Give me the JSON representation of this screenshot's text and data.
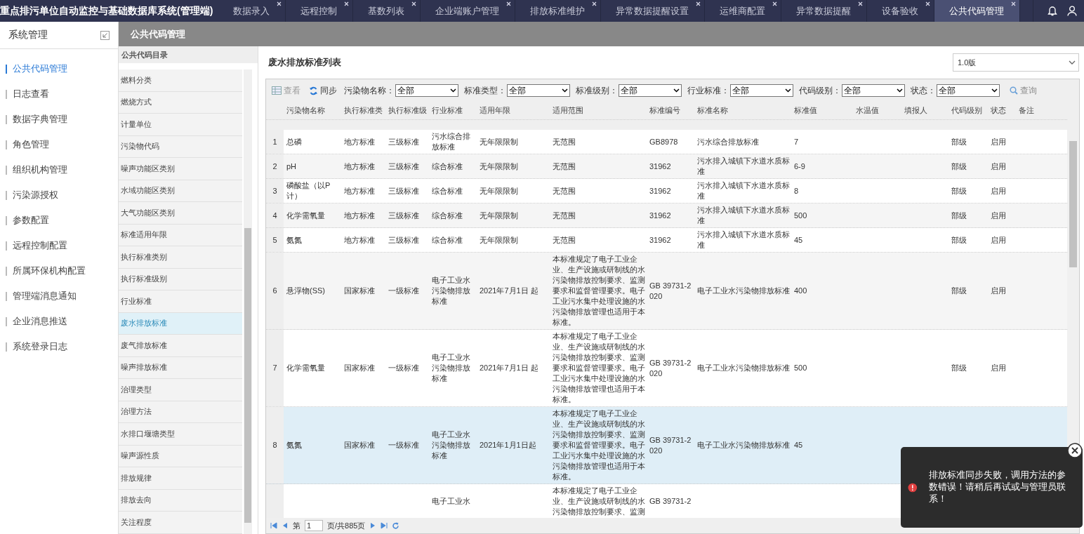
{
  "app_title": "重点排污单位自动监控与基础数据库系统(管理端)",
  "tabs": [
    {
      "label": "数据录入",
      "selected": false
    },
    {
      "label": "远程控制",
      "selected": false
    },
    {
      "label": "基数列表",
      "selected": false
    },
    {
      "label": "企业端账户管理",
      "selected": false
    },
    {
      "label": "排放标准维护",
      "selected": false
    },
    {
      "label": "异常数据提醒设置",
      "selected": false
    },
    {
      "label": "运维商配置",
      "selected": false
    },
    {
      "label": "异常数据提醒",
      "selected": false
    },
    {
      "label": "设备验收",
      "selected": false
    },
    {
      "label": "公共代码管理",
      "selected": true
    }
  ],
  "sidebar": {
    "title": "系统管理",
    "items": [
      {
        "label": "公共代码管理",
        "selected": true
      },
      {
        "label": "日志查看",
        "selected": false
      },
      {
        "label": "数据字典管理",
        "selected": false
      },
      {
        "label": "角色管理",
        "selected": false
      },
      {
        "label": "组织机构管理",
        "selected": false
      },
      {
        "label": "污染源授权",
        "selected": false
      },
      {
        "label": "参数配置",
        "selected": false
      },
      {
        "label": "远程控制配置",
        "selected": false
      },
      {
        "label": "所属环保机构配置",
        "selected": false
      },
      {
        "label": "管理端消息通知",
        "selected": false
      },
      {
        "label": "企业消息推送",
        "selected": false
      },
      {
        "label": "系统登录日志",
        "selected": false
      }
    ]
  },
  "page_header": "公共代码管理",
  "directory": {
    "title": "公共代码目录",
    "items": [
      {
        "label": "燃料分类",
        "selected": false
      },
      {
        "label": "燃烧方式",
        "selected": false
      },
      {
        "label": "计量单位",
        "selected": false
      },
      {
        "label": "污染物代码",
        "selected": false
      },
      {
        "label": "噪声功能区类别",
        "selected": false
      },
      {
        "label": "水域功能区类别",
        "selected": false
      },
      {
        "label": "大气功能区类别",
        "selected": false
      },
      {
        "label": "标准适用年限",
        "selected": false
      },
      {
        "label": "执行标准类别",
        "selected": false
      },
      {
        "label": "执行标准级别",
        "selected": false
      },
      {
        "label": "行业标准",
        "selected": false
      },
      {
        "label": "废水排放标准",
        "selected": true
      },
      {
        "label": "废气排放标准",
        "selected": false
      },
      {
        "label": "噪声排放标准",
        "selected": false
      },
      {
        "label": "治理类型",
        "selected": false
      },
      {
        "label": "治理方法",
        "selected": false
      },
      {
        "label": "水排口堰塘类型",
        "selected": false
      },
      {
        "label": "噪声源性质",
        "selected": false
      },
      {
        "label": "排放规律",
        "selected": false
      },
      {
        "label": "排放去向",
        "selected": false
      },
      {
        "label": "关注程度",
        "selected": false
      }
    ]
  },
  "list": {
    "title": "废水排放标准列表",
    "version": "1.0版"
  },
  "toolbar": {
    "buttons": [
      {
        "kind": "view",
        "label": "查看",
        "disabled": true
      },
      {
        "kind": "sync",
        "label": "同步",
        "disabled": false
      }
    ],
    "filters": [
      {
        "label": "污染物名称：",
        "value": "全部"
      },
      {
        "label": "标准类型：",
        "value": "全部"
      },
      {
        "label": "标准级别：",
        "value": "全部"
      },
      {
        "label": "行业标准：",
        "value": "全部"
      },
      {
        "label": "代码级别：",
        "value": "全部"
      },
      {
        "label": "状态：",
        "value": "全部"
      }
    ],
    "search": "查询"
  },
  "table": {
    "columns": [
      "污染物名称",
      "执行标准类",
      "执行标准级",
      "行业标准",
      "适用年限",
      "适用范围",
      "标准编号",
      "标准名称",
      "标准值",
      "水温值",
      "填报人",
      "代码级别",
      "状态",
      "备注"
    ],
    "rows": [
      {
        "no": "1",
        "pollutant": "总磷",
        "std_type": "地方标准",
        "std_level": "三级标准",
        "industry": "污水综合排放标准",
        "period": "无年限限制",
        "scope": "无范围",
        "code": "GB8978",
        "name": "污水综合排放标准",
        "value": "7",
        "level_code": "部级",
        "status": "启用",
        "selected": false
      },
      {
        "no": "2",
        "pollutant": "pH",
        "std_type": "地方标准",
        "std_level": "三级标准",
        "industry": "综合标准",
        "period": "无年限限制",
        "scope": "无范围",
        "code": "31962",
        "name": "污水排入城镇下水道水质标准",
        "value": "6-9",
        "level_code": "部级",
        "status": "启用",
        "selected": false
      },
      {
        "no": "3",
        "pollutant": "磷酸盐（以P计）",
        "std_type": "地方标准",
        "std_level": "三级标准",
        "industry": "综合标准",
        "period": "无年限限制",
        "scope": "无范围",
        "code": "31962",
        "name": "污水排入城镇下水道水质标准",
        "value": "8",
        "level_code": "部级",
        "status": "启用",
        "selected": false
      },
      {
        "no": "4",
        "pollutant": "化学需氧量",
        "std_type": "地方标准",
        "std_level": "三级标准",
        "industry": "综合标准",
        "period": "无年限限制",
        "scope": "无范围",
        "code": "31962",
        "name": "污水排入城镇下水道水质标准",
        "value": "500",
        "level_code": "部级",
        "status": "启用",
        "selected": false
      },
      {
        "no": "5",
        "pollutant": "氨氮",
        "std_type": "地方标准",
        "std_level": "三级标准",
        "industry": "综合标准",
        "period": "无年限限制",
        "scope": "无范围",
        "code": "31962",
        "name": "污水排入城镇下水道水质标准",
        "value": "45",
        "level_code": "部级",
        "status": "启用",
        "selected": false
      },
      {
        "no": "6",
        "pollutant": "悬浮物(SS)",
        "std_type": "国家标准",
        "std_level": "一级标准",
        "industry": "电子工业水污染物排放标准",
        "period": "2021年7月1日 起",
        "scope": "本标准规定了电子工业企业、生产设施或研制线的水污染物排放控制要求、监测要求和监督管理要求。电子工业污水集中处理设施的水污染物排放管理也适用于本标准。",
        "code": "GB 39731-2020",
        "name": "电子工业水污染物排放标准",
        "value": "400",
        "level_code": "部级",
        "status": "启用",
        "selected": false
      },
      {
        "no": "7",
        "pollutant": "化学需氧量",
        "std_type": "国家标准",
        "std_level": "一级标准",
        "industry": "电子工业水污染物排放标准",
        "period": "2021年7月1日 起",
        "scope": "本标准规定了电子工业企业、生产设施或研制线的水污染物排放控制要求、监测要求和监督管理要求。电子工业污水集中处理设施的水污染物排放管理也适用于本标准。",
        "code": "GB 39731-2020",
        "name": "电子工业水污染物排放标准",
        "value": "500",
        "level_code": "部级",
        "status": "启用",
        "selected": false
      },
      {
        "no": "8",
        "pollutant": "氨氮",
        "std_type": "国家标准",
        "std_level": "一级标准",
        "industry": "电子工业水污染物排放标准",
        "period": "2021年1月1日起",
        "scope": "本标准规定了电子工业企业、生产设施或研制线的水污染物排放控制要求、监测要求和监督管理要求。电子工业污水集中处理设施的水污染物排放管理也适用于本标准。",
        "code": "GB 39731-2020",
        "name": "电子工业水污染物排放标准",
        "value": "45",
        "selected": true
      },
      {
        "industry": "电子工业水",
        "scope": "本标准规定了电子工业企业、生产设施或研制线的水污染物排放控制要求、监测",
        "code": "GB 39731-2",
        "selected": false
      }
    ]
  },
  "pager": {
    "prefix": "第",
    "page": "1",
    "suffix": "页/共885页"
  },
  "toast": {
    "message": "排放标准同步失败，调用方法的参数错误！请稍后再试或与管理员联系！"
  }
}
